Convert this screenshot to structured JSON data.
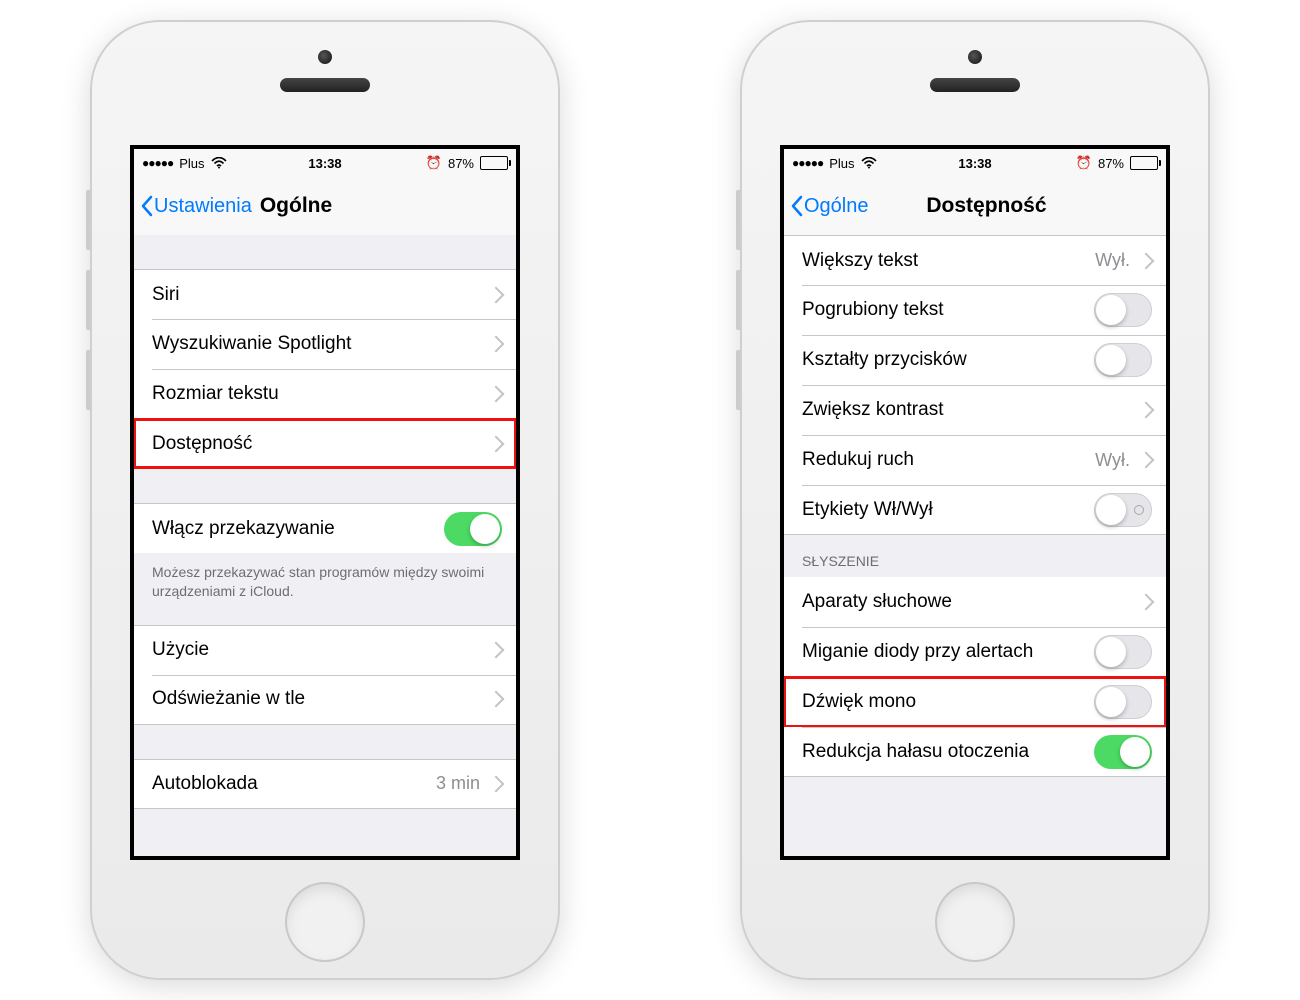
{
  "status": {
    "carrier": "Plus",
    "time": "13:38",
    "battery_pct": "87%",
    "signal_dots": "●●●●●",
    "alarm_glyph": "⏰"
  },
  "left": {
    "back": "Ustawienia",
    "title": "Ogólne",
    "rows": {
      "siri": "Siri",
      "spotlight": "Wyszukiwanie Spotlight",
      "textsize": "Rozmiar tekstu",
      "accessibility": "Dostępność",
      "handoff": "Włącz przekazywanie",
      "handoff_note": "Możesz przekazywać stan programów między swoimi urządzeniami z iCloud.",
      "usage": "Użycie",
      "refresh": "Odświeżanie w tle",
      "autolock": "Autoblokada",
      "autolock_value": "3 min"
    }
  },
  "right": {
    "back": "Ogólne",
    "title": "Dostępność",
    "rows": {
      "larger_text": "Większy tekst",
      "larger_text_value": "Wył.",
      "bold_text": "Pogrubiony tekst",
      "button_shapes": "Kształty przycisków",
      "increase_contrast": "Zwiększ kontrast",
      "reduce_motion": "Redukuj ruch",
      "reduce_motion_value": "Wył.",
      "onoff_labels": "Etykiety Wł/Wył",
      "hearing_header": "SŁYSZENIE",
      "hearing_aids": "Aparaty słuchowe",
      "led_flash": "Miganie diody przy alertach",
      "mono_audio": "Dźwięk mono",
      "noise_reduction": "Redukcja hałasu otoczenia"
    }
  }
}
